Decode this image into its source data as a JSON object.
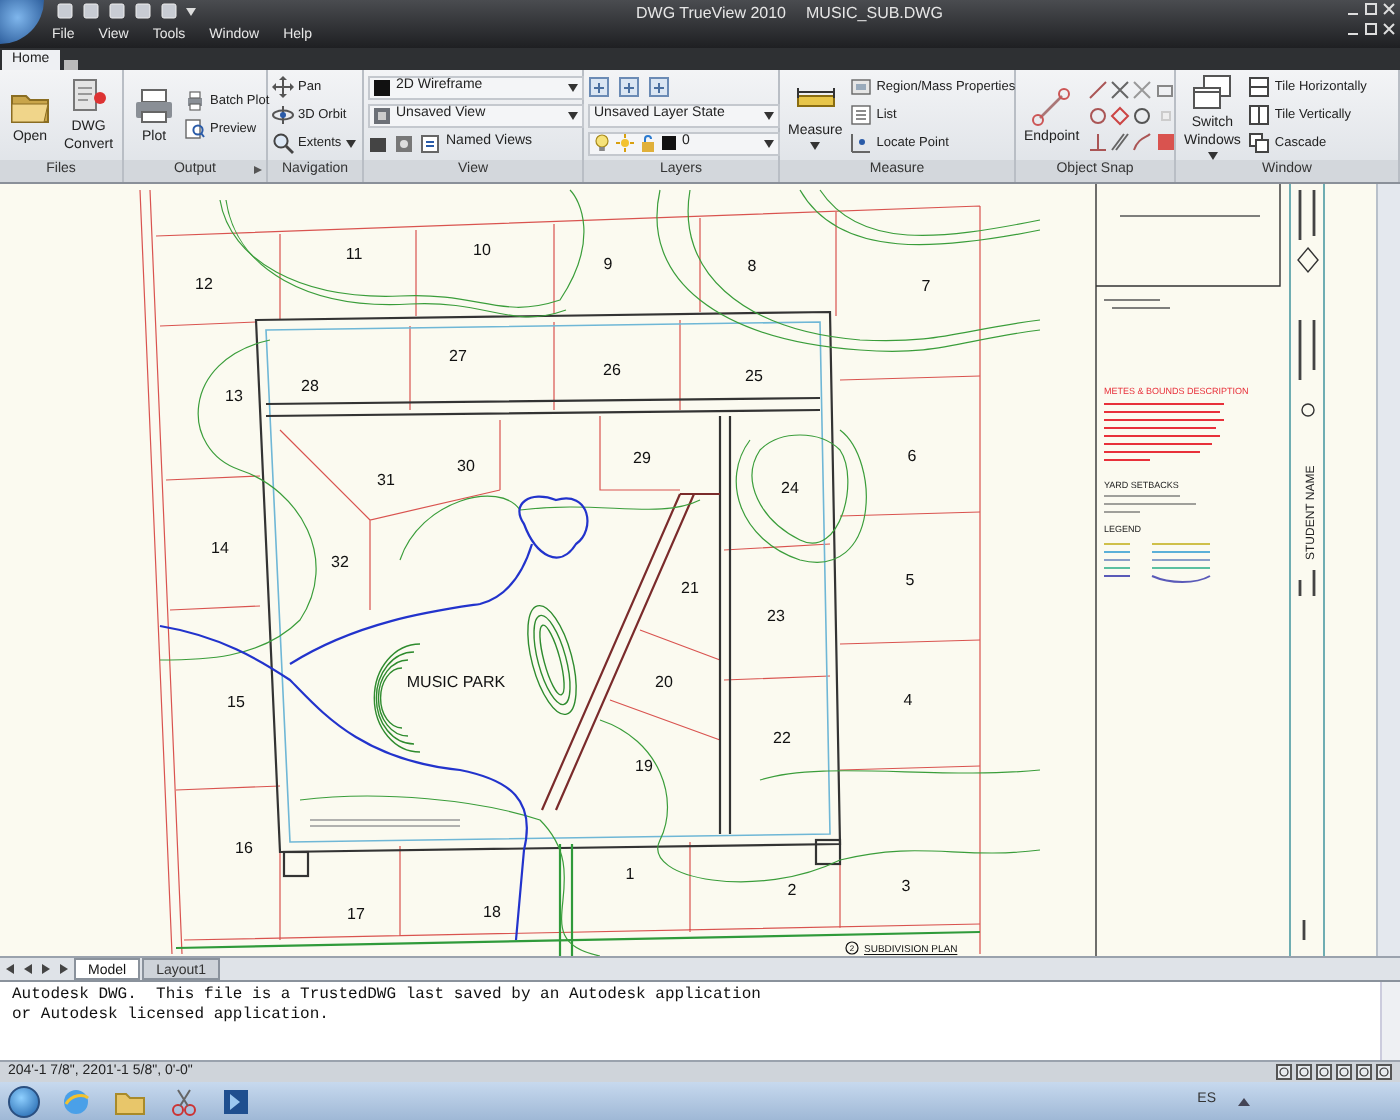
{
  "title_bar": {
    "app": "DWG TrueView 2010",
    "document": "MUSIC_SUB.DWG"
  },
  "menu": [
    "File",
    "View",
    "Tools",
    "Window",
    "Help"
  ],
  "ribbon_tabs": [
    {
      "label": "Home",
      "selected": true
    }
  ],
  "ribbon_panels": [
    {
      "title": "Files",
      "items": [
        {
          "kind": "large",
          "label": "Open"
        },
        {
          "kind": "large",
          "label": "DWG Convert"
        }
      ]
    },
    {
      "title": "Output",
      "launcher": true,
      "items": [
        {
          "kind": "large",
          "label": "Plot"
        },
        {
          "kind": "small",
          "label": "Batch Plot"
        },
        {
          "kind": "small",
          "label": "Preview"
        }
      ]
    },
    {
      "title": "Navigation",
      "items": [
        {
          "kind": "small",
          "label": "Pan"
        },
        {
          "kind": "small",
          "label": "3D Orbit"
        },
        {
          "kind": "small",
          "label": "Extents",
          "menu": true
        }
      ]
    },
    {
      "title": "View",
      "items": [
        {
          "kind": "dropdown",
          "label": "2D Wireframe"
        },
        {
          "kind": "dropdown",
          "label": "Unsaved View"
        },
        {
          "kind": "toolrow",
          "label": "Named Views"
        }
      ]
    },
    {
      "title": "Layers",
      "items": [
        {
          "kind": "iconrow"
        },
        {
          "kind": "dropdown",
          "label": "Unsaved Layer State"
        },
        {
          "kind": "layerrow",
          "label": "0"
        }
      ]
    },
    {
      "title": "Measure",
      "items": [
        {
          "kind": "large",
          "label": "Measure",
          "menu": true
        },
        {
          "kind": "small",
          "label": "Region/Mass Properties"
        },
        {
          "kind": "small",
          "label": "List"
        },
        {
          "kind": "small",
          "label": "Locate Point"
        }
      ]
    },
    {
      "title": "Object Snap",
      "items": [
        {
          "kind": "large",
          "label": "Endpoint"
        },
        {
          "kind": "snapgrid"
        }
      ]
    },
    {
      "title": "Window",
      "items": [
        {
          "kind": "large",
          "label": "Switch Windows",
          "menu": true
        },
        {
          "kind": "small",
          "label": "Tile Horizontally"
        },
        {
          "kind": "small",
          "label": "Tile Vertically"
        },
        {
          "kind": "small",
          "label": "Cascade"
        }
      ]
    }
  ],
  "drawing": {
    "lots": [
      "11",
      "10",
      "9",
      "8",
      "7",
      "12",
      "13",
      "28",
      "27",
      "26",
      "25",
      "6",
      "31",
      "30",
      "29",
      "24",
      "14",
      "32",
      "21",
      "5",
      "23",
      "15",
      "20",
      "4",
      "22",
      "19",
      "16",
      "1",
      "2",
      "3",
      "17",
      "18"
    ],
    "park_label": "MUSIC PARK",
    "sheet_headings": [
      "METES & BOUNDS DESCRIPTION",
      "YARD SETBACKS",
      "LEGEND"
    ],
    "student_label": "STUDENT NAME",
    "plan_number": "2",
    "plan_title": "SUBDIVISION PLAN"
  },
  "layout_tabs": [
    {
      "label": "Model",
      "selected": true
    },
    {
      "label": "Layout1",
      "selected": false
    }
  ],
  "command_line": [
    "Autodesk DWG.  This file is a TrustedDWG last saved by an Autodesk application",
    "or Autodesk licensed application."
  ],
  "status_bar": {
    "coordinates": "204'-1 7/8\", 2201'-1 5/8\", 0'-0\""
  },
  "taskbar": {
    "language": "ES"
  }
}
